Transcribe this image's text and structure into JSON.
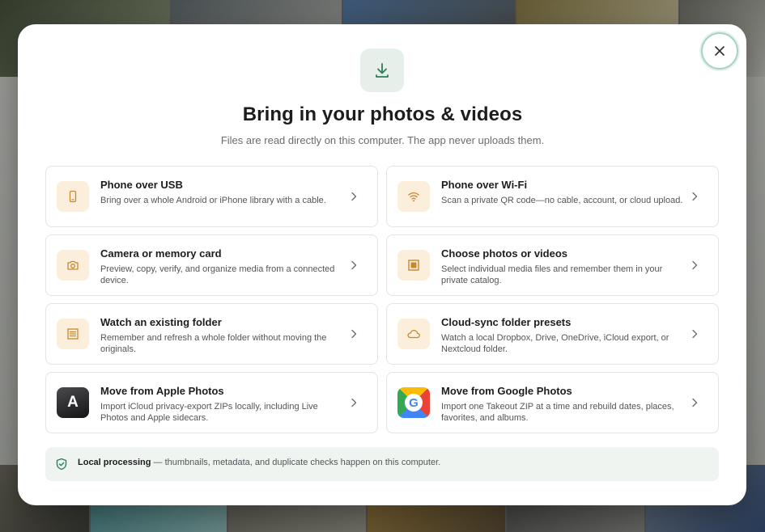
{
  "dialog": {
    "title": "Bring in your photos & videos",
    "subtitle": "Files are read directly on this computer. The app never uploads them."
  },
  "options": [
    {
      "title": "Phone over USB",
      "description": "Bring over a whole Android or iPhone library with a cable.",
      "icon": "phone-icon"
    },
    {
      "title": "Phone over Wi-Fi",
      "description": "Scan a private QR code—no cable, account, or cloud upload.",
      "icon": "wifi-icon"
    },
    {
      "title": "Camera or memory card",
      "description": "Preview, copy, verify, and organize media from a connected device.",
      "icon": "camera-icon"
    },
    {
      "title": "Choose photos or videos",
      "description": "Select individual media files and remember them in your private catalog.",
      "icon": "photo-frame-icon"
    },
    {
      "title": "Watch an existing folder",
      "description": "Remember and refresh a whole folder without moving the originals.",
      "icon": "folder-list-icon"
    },
    {
      "title": "Cloud-sync folder presets",
      "description": "Watch a local Dropbox, Drive, OneDrive, iCloud export, or Nextcloud folder.",
      "icon": "cloud-icon"
    },
    {
      "title": "Move from Apple Photos",
      "description": "Import iCloud privacy-export ZIPs locally, including Live Photos and Apple sidecars.",
      "icon": "apple-photos-icon",
      "glyph": "A"
    },
    {
      "title": "Move from Google Photos",
      "description": "Import one Takeout ZIP at a time and rebuild dates, places, favorites, and albums.",
      "icon": "google-photos-icon",
      "glyph": "G"
    }
  ],
  "footer": {
    "bold": "Local processing",
    "text": " — thumbnails, metadata, and duplicate checks happen on this computer."
  },
  "colors": {
    "accent": "#2e7d5b",
    "icon_orange": "#c8862f",
    "icon_bg": "#fbefdc",
    "footer_bg": "#eff4f1"
  }
}
